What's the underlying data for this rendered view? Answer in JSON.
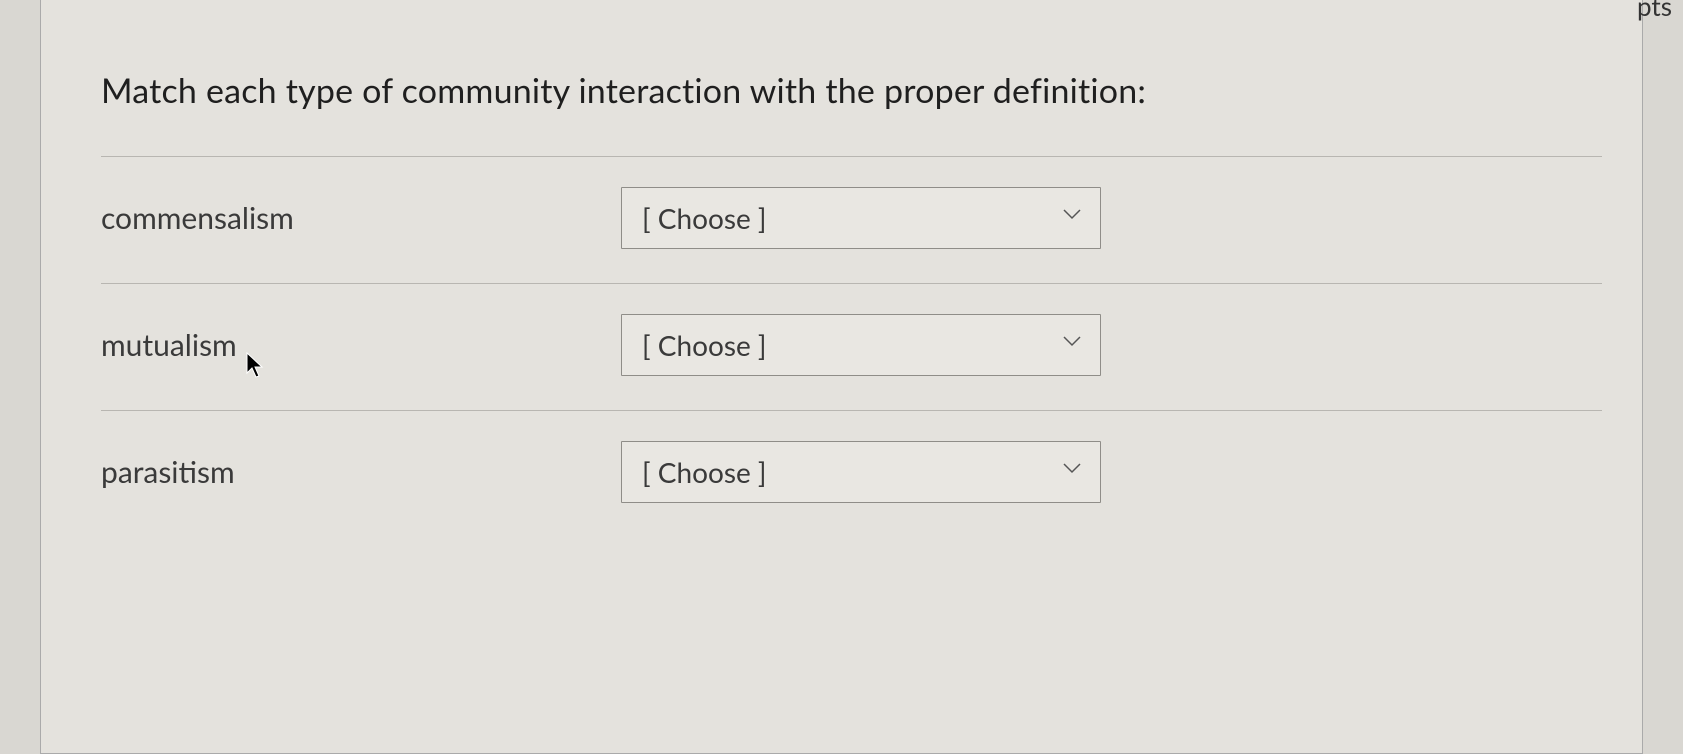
{
  "header": {
    "points_fragment": "pts"
  },
  "question": {
    "prompt": "Match each type of community interaction with the proper definition:",
    "choose_placeholder": "[ Choose ]",
    "items": [
      {
        "label": "commensalism",
        "selected": "[ Choose ]"
      },
      {
        "label": "mutualism",
        "selected": "[ Choose ]"
      },
      {
        "label": "parasitism",
        "selected": "[ Choose ]"
      }
    ]
  }
}
